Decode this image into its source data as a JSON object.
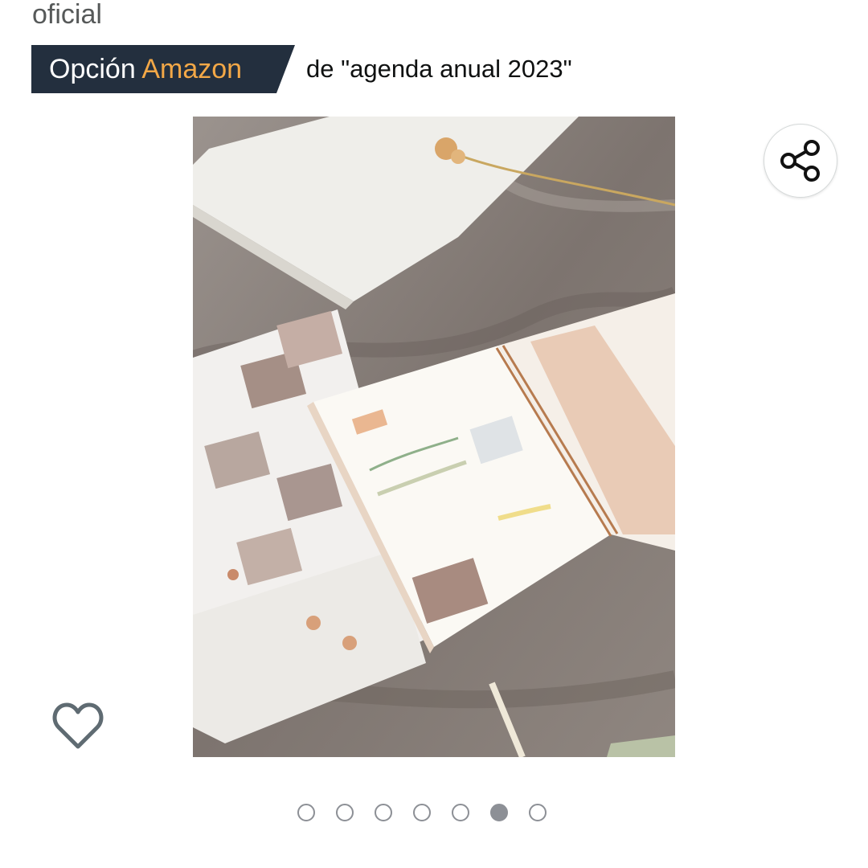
{
  "header": {
    "top_text": "oficial"
  },
  "badge": {
    "label_part1": "Opción",
    "label_part2": "Amazon",
    "suffix": "de \"agenda anual 2023\"",
    "colors": {
      "background": "#232f3e",
      "accent": "#f3a847"
    }
  },
  "gallery": {
    "image_semantic": "planner-notebook-photo",
    "share_icon": "share-icon",
    "wishlist_icon": "heart-icon",
    "dot_count": 7,
    "active_index": 5
  }
}
